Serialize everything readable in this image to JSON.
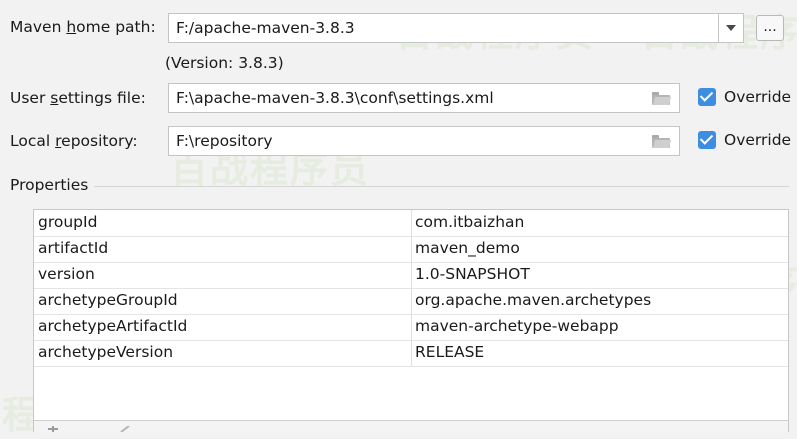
{
  "maven_home": {
    "label_pre": "Maven ",
    "label_u": "h",
    "label_post": "ome path:",
    "value": "F:/apache-maven-3.8.3",
    "browse_label": "...",
    "version_text": "(Version: 3.8.3)"
  },
  "user_settings": {
    "label_pre": "User ",
    "label_u": "s",
    "label_post": "ettings file:",
    "value": "F:\\apache-maven-3.8.3\\conf\\settings.xml",
    "override_label": "Override",
    "override_checked": true
  },
  "local_repo": {
    "label_pre": "Local ",
    "label_u": "r",
    "label_post": "epository:",
    "value": "F:\\repository",
    "override_label": "Override",
    "override_checked": true
  },
  "properties": {
    "title": "Properties",
    "rows": [
      {
        "key": "groupId",
        "value": "com.itbaizhan"
      },
      {
        "key": "artifactId",
        "value": "maven_demo"
      },
      {
        "key": "version",
        "value": "1.0-SNAPSHOT"
      },
      {
        "key": "archetypeGroupId",
        "value": "org.apache.maven.archetypes"
      },
      {
        "key": "archetypeArtifactId",
        "value": "maven-archetype-webapp"
      },
      {
        "key": "archetypeVersion",
        "value": "RELEASE"
      }
    ]
  },
  "watermark": "百战程序员",
  "colors": {
    "accent": "#3d8ee0",
    "background": "#f2f2f2"
  }
}
